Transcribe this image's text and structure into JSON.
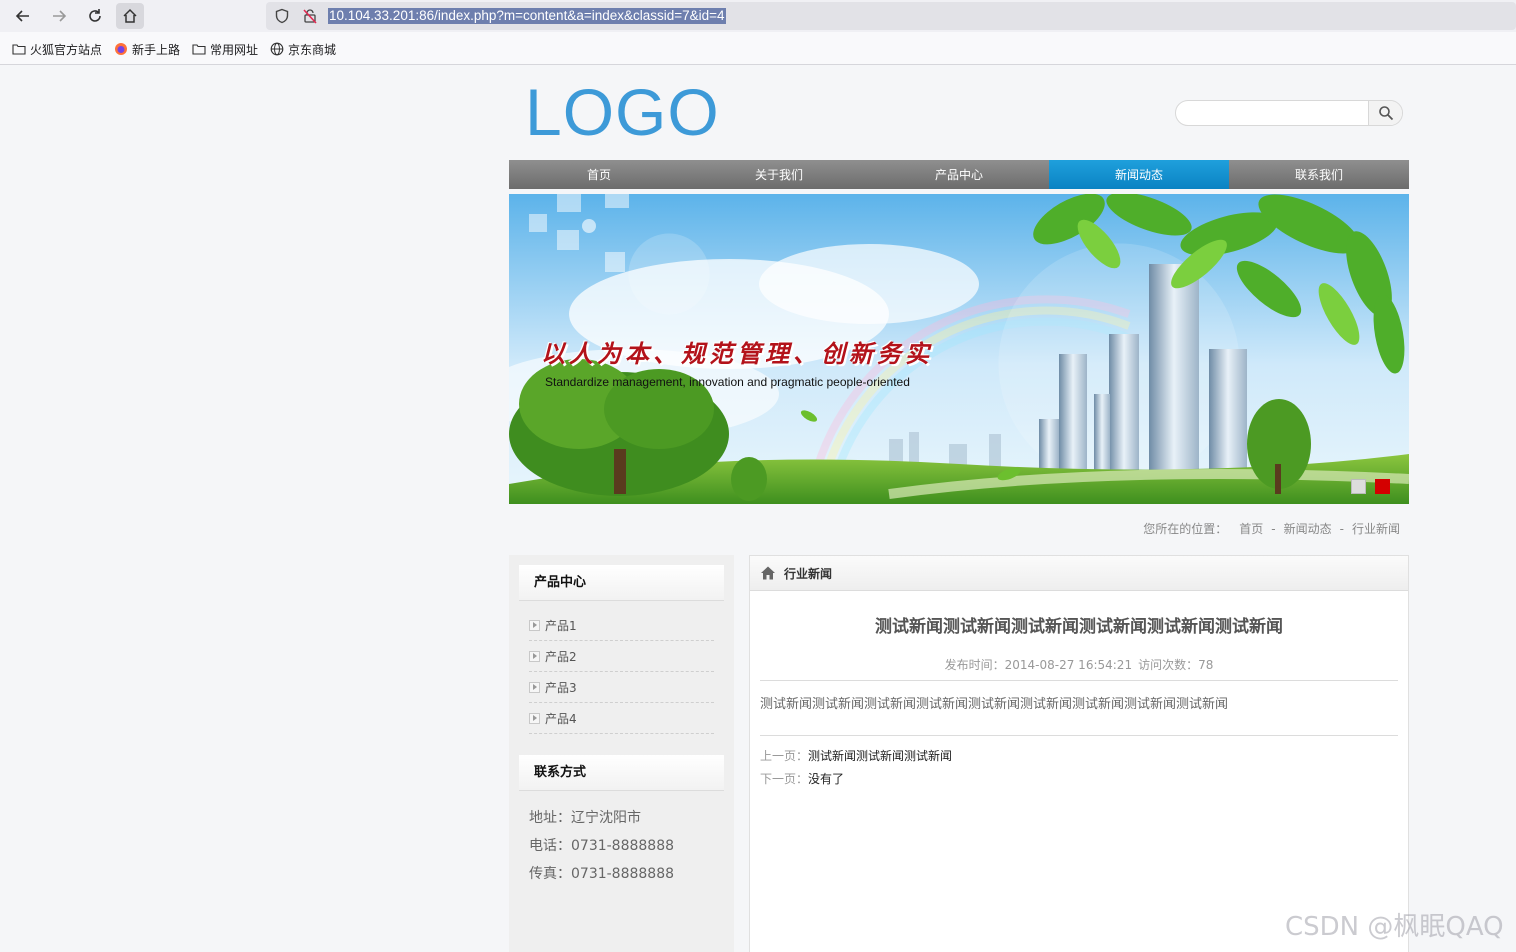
{
  "browser": {
    "url": "10.104.33.201:86/index.php?m=content&a=index&classid=7&id=4",
    "bookmarks": [
      {
        "label": "火狐官方站点",
        "icon": "folder-icon"
      },
      {
        "label": "新手上路",
        "icon": "firefox-icon"
      },
      {
        "label": "常用网址",
        "icon": "folder-icon"
      },
      {
        "label": "京东商城",
        "icon": "globe-icon"
      }
    ]
  },
  "header": {
    "logo": "LOGO",
    "search_placeholder": ""
  },
  "nav": {
    "items": [
      "首页",
      "关于我们",
      "产品中心",
      "新闻动态",
      "联系我们"
    ],
    "active_index": 3
  },
  "banner": {
    "title": "以人为本、规范管理、创新务实",
    "subtitle": "Standardize management, innovation and pragmatic people-oriented"
  },
  "breadcrumb": {
    "prefix": "您所在的位置：",
    "items": [
      "首页",
      "-",
      "新闻动态",
      "-",
      "行业新闻"
    ]
  },
  "sidebar": {
    "products_title": "产品中心",
    "products": [
      "产品1",
      "产品2",
      "产品3",
      "产品4"
    ],
    "contact_title": "联系方式",
    "contact": [
      "地址：辽宁沈阳市",
      "电话：0731-8888888",
      "传真：0731-8888888"
    ]
  },
  "main": {
    "section_title": "行业新闻",
    "article_title": "测试新闻测试新闻测试新闻测试新闻测试新闻测试新闻",
    "publish_label": "发布时间：2014-08-27 16:54:21",
    "visits_label": "访问次数：78",
    "body": "测试新闻测试新闻测试新闻测试新闻测试新闻测试新闻测试新闻测试新闻测试新闻",
    "prev_label": "上一页：",
    "prev_link": "测试新闻测试新闻测试新闻",
    "next_label": "下一页：",
    "next_link": "没有了"
  },
  "watermark": "CSDN @枫眠QAQ",
  "colors": {
    "accent": "#0a8fd0",
    "logo": "#3d9ad8",
    "banner_title": "#b3121a"
  }
}
